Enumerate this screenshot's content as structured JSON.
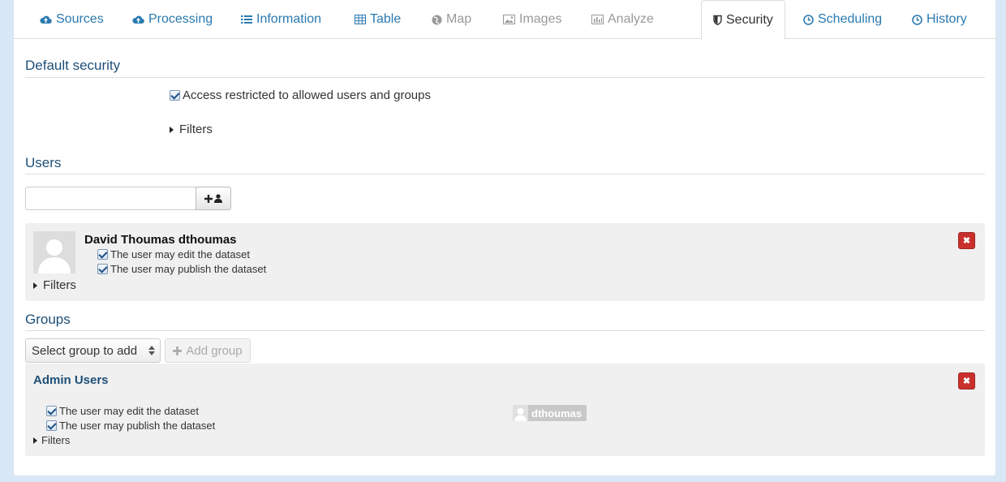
{
  "tabs": [
    {
      "label": "Sources",
      "icon": "cloud-upload-icon"
    },
    {
      "label": "Processing",
      "icon": "cloud-upload-icon"
    },
    {
      "label": "Information",
      "icon": "list-icon"
    },
    {
      "label": "Table",
      "icon": "table-icon"
    },
    {
      "label": "Map",
      "icon": "globe-icon"
    },
    {
      "label": "Images",
      "icon": "image-icon"
    },
    {
      "label": "Analyze",
      "icon": "bar-chart-icon"
    },
    {
      "label": "Security",
      "icon": "shield-icon"
    },
    {
      "label": "Scheduling",
      "icon": "clock-icon"
    },
    {
      "label": "History",
      "icon": "clock-icon"
    }
  ],
  "active_tab": "Security",
  "default_security": {
    "title": "Default security",
    "access_restricted_label": "Access restricted to allowed users and groups",
    "access_restricted_checked": true,
    "filters_label": "Filters"
  },
  "users": {
    "title": "Users",
    "search_value": "",
    "list": [
      {
        "name": "David Thoumas dthoumas",
        "can_edit_label": "The user may edit the dataset",
        "can_edit": true,
        "can_publish_label": "The user may publish the dataset",
        "can_publish": true,
        "filters_label": "Filters"
      }
    ]
  },
  "groups": {
    "title": "Groups",
    "select_placeholder": "Select group to add",
    "add_group_label": "Add group",
    "list": [
      {
        "name": "Admin Users",
        "can_edit_label": "The user may edit the dataset",
        "can_edit": true,
        "can_publish_label": "The user may publish the dataset",
        "can_publish": true,
        "filters_label": "Filters",
        "members": [
          "dthoumas"
        ]
      }
    ]
  },
  "colors": {
    "link": "#2a7ab0",
    "section_title": "#1e4f78",
    "danger": "#c9302c",
    "background": "#d9e8f7"
  }
}
